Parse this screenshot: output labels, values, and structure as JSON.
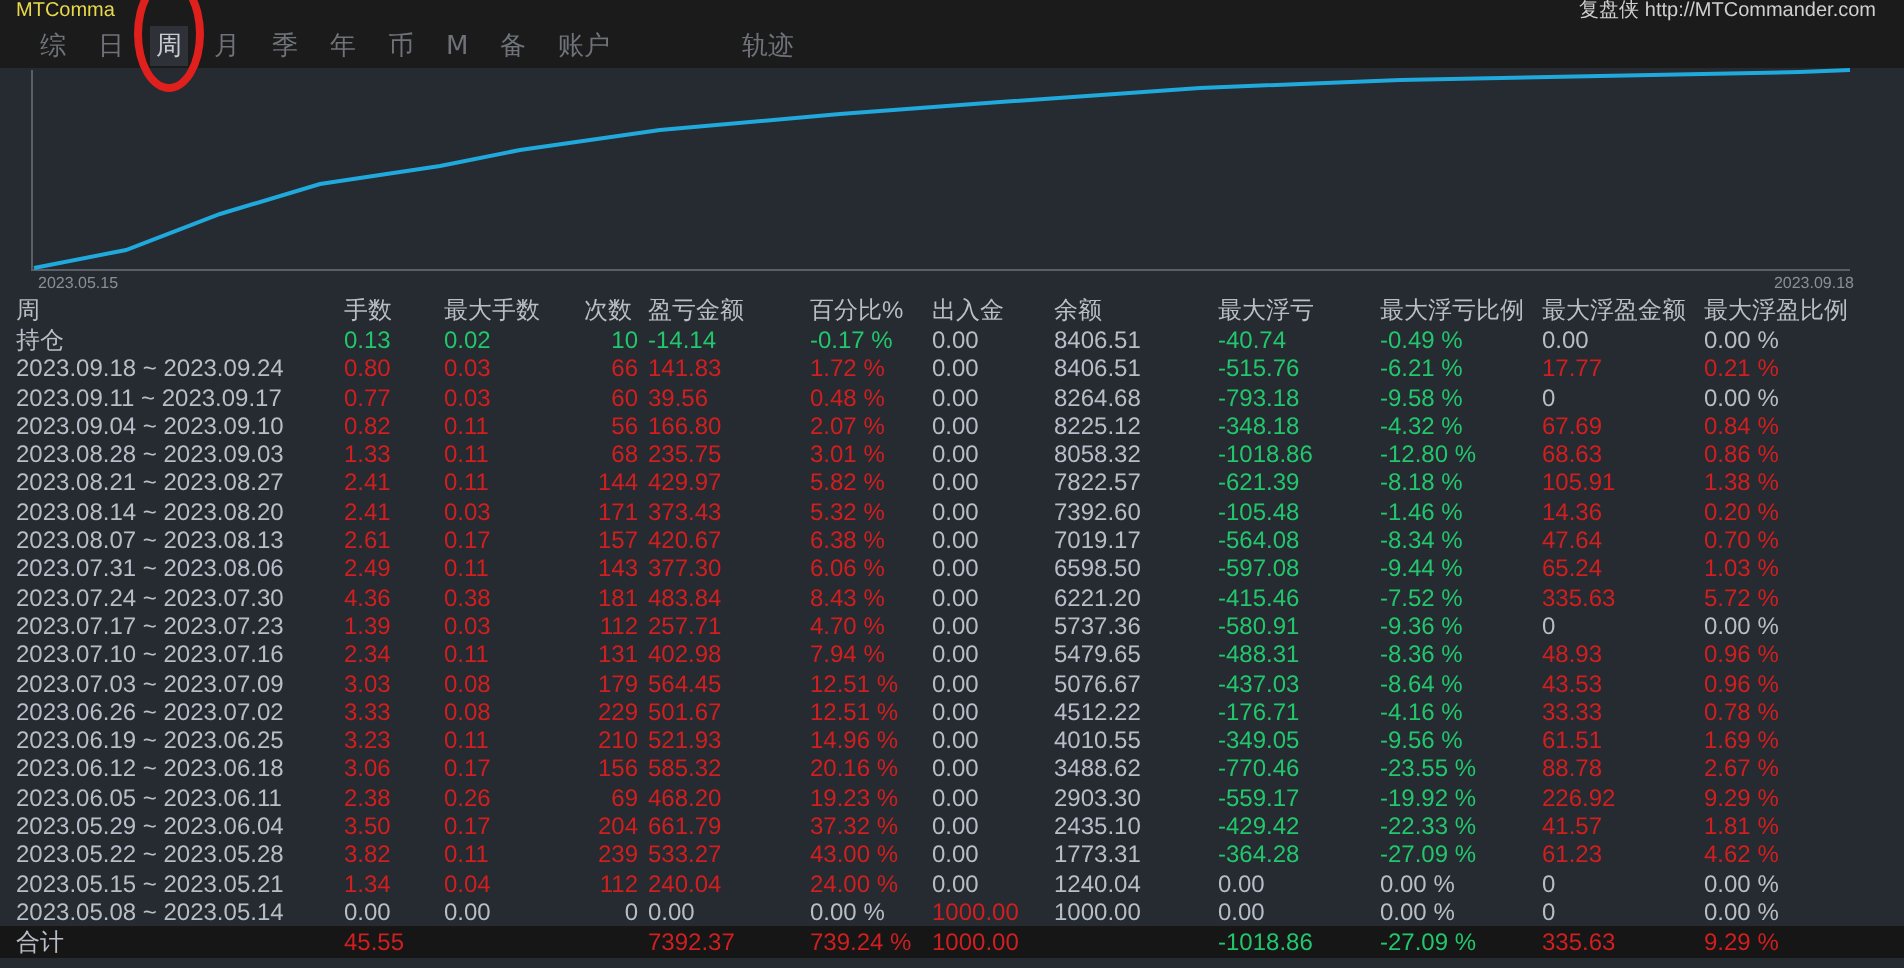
{
  "app": {
    "title": "MTComma",
    "brand": "复盘侠 http://MTCommander.com"
  },
  "tabs": [
    {
      "label": "综",
      "selected": false
    },
    {
      "label": "日",
      "selected": false
    },
    {
      "label": "周",
      "selected": true
    },
    {
      "label": "月",
      "selected": false
    },
    {
      "label": "季",
      "selected": false
    },
    {
      "label": "年",
      "selected": false
    },
    {
      "label": "币",
      "selected": false
    },
    {
      "label": "M",
      "selected": false
    },
    {
      "label": "备",
      "selected": false
    },
    {
      "label": "账户",
      "selected": false
    },
    {
      "label": "轨迹",
      "selected": false
    }
  ],
  "chart": {
    "start_label": "2023.05.15",
    "end_label": "2023.09.18"
  },
  "table": {
    "columns": [
      "周",
      "手数",
      "最大手数",
      "次数",
      "盈亏金额",
      "百分比%",
      "出入金",
      "余额",
      "最大浮亏",
      "最大浮亏比例",
      "最大浮盈金额",
      "最大浮盈比例"
    ],
    "rows": [
      {
        "cells": [
          {
            "text": "持仓",
            "kind": "label"
          },
          {
            "text": "0.13",
            "kind": "down"
          },
          {
            "text": "0.02",
            "kind": "down"
          },
          {
            "text": "10",
            "kind": "down"
          },
          {
            "text": "-14.14",
            "kind": "down"
          },
          {
            "text": "-0.17 %",
            "kind": "down"
          },
          {
            "text": "0.00",
            "kind": "flat"
          },
          {
            "text": "8406.51",
            "kind": "flat"
          },
          {
            "text": "-40.74",
            "kind": "down"
          },
          {
            "text": "-0.49 %",
            "kind": "down"
          },
          {
            "text": "0.00",
            "kind": "flat"
          },
          {
            "text": "0.00 %",
            "kind": "flat"
          }
        ]
      },
      {
        "cells": [
          {
            "text": "2023.09.18 ~ 2023.09.24",
            "kind": "label"
          },
          {
            "text": "0.80",
            "kind": "up"
          },
          {
            "text": "0.03",
            "kind": "up"
          },
          {
            "text": "66",
            "kind": "up"
          },
          {
            "text": "141.83",
            "kind": "up"
          },
          {
            "text": "1.72 %",
            "kind": "up"
          },
          {
            "text": "0.00",
            "kind": "flat"
          },
          {
            "text": "8406.51",
            "kind": "flat"
          },
          {
            "text": "-515.76",
            "kind": "down"
          },
          {
            "text": "-6.21 %",
            "kind": "down"
          },
          {
            "text": "17.77",
            "kind": "up"
          },
          {
            "text": "0.21 %",
            "kind": "up"
          }
        ]
      },
      {
        "cells": [
          {
            "text": "2023.09.11 ~ 2023.09.17",
            "kind": "label"
          },
          {
            "text": "0.77",
            "kind": "up"
          },
          {
            "text": "0.03",
            "kind": "up"
          },
          {
            "text": "60",
            "kind": "up"
          },
          {
            "text": "39.56",
            "kind": "up"
          },
          {
            "text": "0.48 %",
            "kind": "up"
          },
          {
            "text": "0.00",
            "kind": "flat"
          },
          {
            "text": "8264.68",
            "kind": "flat"
          },
          {
            "text": "-793.18",
            "kind": "down"
          },
          {
            "text": "-9.58 %",
            "kind": "down"
          },
          {
            "text": "0",
            "kind": "flat"
          },
          {
            "text": "0.00 %",
            "kind": "flat"
          }
        ]
      },
      {
        "cells": [
          {
            "text": "2023.09.04 ~ 2023.09.10",
            "kind": "label"
          },
          {
            "text": "0.82",
            "kind": "up"
          },
          {
            "text": "0.11",
            "kind": "up"
          },
          {
            "text": "56",
            "kind": "up"
          },
          {
            "text": "166.80",
            "kind": "up"
          },
          {
            "text": "2.07 %",
            "kind": "up"
          },
          {
            "text": "0.00",
            "kind": "flat"
          },
          {
            "text": "8225.12",
            "kind": "flat"
          },
          {
            "text": "-348.18",
            "kind": "down"
          },
          {
            "text": "-4.32 %",
            "kind": "down"
          },
          {
            "text": "67.69",
            "kind": "up"
          },
          {
            "text": "0.84 %",
            "kind": "up"
          }
        ]
      },
      {
        "cells": [
          {
            "text": "2023.08.28 ~ 2023.09.03",
            "kind": "label"
          },
          {
            "text": "1.33",
            "kind": "up"
          },
          {
            "text": "0.11",
            "kind": "up"
          },
          {
            "text": "68",
            "kind": "up"
          },
          {
            "text": "235.75",
            "kind": "up"
          },
          {
            "text": "3.01 %",
            "kind": "up"
          },
          {
            "text": "0.00",
            "kind": "flat"
          },
          {
            "text": "8058.32",
            "kind": "flat"
          },
          {
            "text": "-1018.86",
            "kind": "down"
          },
          {
            "text": "-12.80 %",
            "kind": "down"
          },
          {
            "text": "68.63",
            "kind": "up"
          },
          {
            "text": "0.86 %",
            "kind": "up"
          }
        ]
      },
      {
        "cells": [
          {
            "text": "2023.08.21 ~ 2023.08.27",
            "kind": "label"
          },
          {
            "text": "2.41",
            "kind": "up"
          },
          {
            "text": "0.11",
            "kind": "up"
          },
          {
            "text": "144",
            "kind": "up"
          },
          {
            "text": "429.97",
            "kind": "up"
          },
          {
            "text": "5.82 %",
            "kind": "up"
          },
          {
            "text": "0.00",
            "kind": "flat"
          },
          {
            "text": "7822.57",
            "kind": "flat"
          },
          {
            "text": "-621.39",
            "kind": "down"
          },
          {
            "text": "-8.18 %",
            "kind": "down"
          },
          {
            "text": "105.91",
            "kind": "up"
          },
          {
            "text": "1.38 %",
            "kind": "up"
          }
        ]
      },
      {
        "cells": [
          {
            "text": "2023.08.14 ~ 2023.08.20",
            "kind": "label"
          },
          {
            "text": "2.41",
            "kind": "up"
          },
          {
            "text": "0.03",
            "kind": "up"
          },
          {
            "text": "171",
            "kind": "up"
          },
          {
            "text": "373.43",
            "kind": "up"
          },
          {
            "text": "5.32 %",
            "kind": "up"
          },
          {
            "text": "0.00",
            "kind": "flat"
          },
          {
            "text": "7392.60",
            "kind": "flat"
          },
          {
            "text": "-105.48",
            "kind": "down"
          },
          {
            "text": "-1.46 %",
            "kind": "down"
          },
          {
            "text": "14.36",
            "kind": "up"
          },
          {
            "text": "0.20 %",
            "kind": "up"
          }
        ]
      },
      {
        "cells": [
          {
            "text": "2023.08.07 ~ 2023.08.13",
            "kind": "label"
          },
          {
            "text": "2.61",
            "kind": "up"
          },
          {
            "text": "0.17",
            "kind": "up"
          },
          {
            "text": "157",
            "kind": "up"
          },
          {
            "text": "420.67",
            "kind": "up"
          },
          {
            "text": "6.38 %",
            "kind": "up"
          },
          {
            "text": "0.00",
            "kind": "flat"
          },
          {
            "text": "7019.17",
            "kind": "flat"
          },
          {
            "text": "-564.08",
            "kind": "down"
          },
          {
            "text": "-8.34 %",
            "kind": "down"
          },
          {
            "text": "47.64",
            "kind": "up"
          },
          {
            "text": "0.70 %",
            "kind": "up"
          }
        ]
      },
      {
        "cells": [
          {
            "text": "2023.07.31 ~ 2023.08.06",
            "kind": "label"
          },
          {
            "text": "2.49",
            "kind": "up"
          },
          {
            "text": "0.11",
            "kind": "up"
          },
          {
            "text": "143",
            "kind": "up"
          },
          {
            "text": "377.30",
            "kind": "up"
          },
          {
            "text": "6.06 %",
            "kind": "up"
          },
          {
            "text": "0.00",
            "kind": "flat"
          },
          {
            "text": "6598.50",
            "kind": "flat"
          },
          {
            "text": "-597.08",
            "kind": "down"
          },
          {
            "text": "-9.44 %",
            "kind": "down"
          },
          {
            "text": "65.24",
            "kind": "up"
          },
          {
            "text": "1.03 %",
            "kind": "up"
          }
        ]
      },
      {
        "cells": [
          {
            "text": "2023.07.24 ~ 2023.07.30",
            "kind": "label"
          },
          {
            "text": "4.36",
            "kind": "up"
          },
          {
            "text": "0.38",
            "kind": "up"
          },
          {
            "text": "181",
            "kind": "up"
          },
          {
            "text": "483.84",
            "kind": "up"
          },
          {
            "text": "8.43 %",
            "kind": "up"
          },
          {
            "text": "0.00",
            "kind": "flat"
          },
          {
            "text": "6221.20",
            "kind": "flat"
          },
          {
            "text": "-415.46",
            "kind": "down"
          },
          {
            "text": "-7.52 %",
            "kind": "down"
          },
          {
            "text": "335.63",
            "kind": "up"
          },
          {
            "text": "5.72 %",
            "kind": "up"
          }
        ]
      },
      {
        "cells": [
          {
            "text": "2023.07.17 ~ 2023.07.23",
            "kind": "label"
          },
          {
            "text": "1.39",
            "kind": "up"
          },
          {
            "text": "0.03",
            "kind": "up"
          },
          {
            "text": "112",
            "kind": "up"
          },
          {
            "text": "257.71",
            "kind": "up"
          },
          {
            "text": "4.70 %",
            "kind": "up"
          },
          {
            "text": "0.00",
            "kind": "flat"
          },
          {
            "text": "5737.36",
            "kind": "flat"
          },
          {
            "text": "-580.91",
            "kind": "down"
          },
          {
            "text": "-9.36 %",
            "kind": "down"
          },
          {
            "text": "0",
            "kind": "flat"
          },
          {
            "text": "0.00 %",
            "kind": "flat"
          }
        ]
      },
      {
        "cells": [
          {
            "text": "2023.07.10 ~ 2023.07.16",
            "kind": "label"
          },
          {
            "text": "2.34",
            "kind": "up"
          },
          {
            "text": "0.11",
            "kind": "up"
          },
          {
            "text": "131",
            "kind": "up"
          },
          {
            "text": "402.98",
            "kind": "up"
          },
          {
            "text": "7.94 %",
            "kind": "up"
          },
          {
            "text": "0.00",
            "kind": "flat"
          },
          {
            "text": "5479.65",
            "kind": "flat"
          },
          {
            "text": "-488.31",
            "kind": "down"
          },
          {
            "text": "-8.36 %",
            "kind": "down"
          },
          {
            "text": "48.93",
            "kind": "up"
          },
          {
            "text": "0.96 %",
            "kind": "up"
          }
        ]
      },
      {
        "cells": [
          {
            "text": "2023.07.03 ~ 2023.07.09",
            "kind": "label"
          },
          {
            "text": "3.03",
            "kind": "up"
          },
          {
            "text": "0.08",
            "kind": "up"
          },
          {
            "text": "179",
            "kind": "up"
          },
          {
            "text": "564.45",
            "kind": "up"
          },
          {
            "text": "12.51 %",
            "kind": "up"
          },
          {
            "text": "0.00",
            "kind": "flat"
          },
          {
            "text": "5076.67",
            "kind": "flat"
          },
          {
            "text": "-437.03",
            "kind": "down"
          },
          {
            "text": "-8.64 %",
            "kind": "down"
          },
          {
            "text": "43.53",
            "kind": "up"
          },
          {
            "text": "0.96 %",
            "kind": "up"
          }
        ]
      },
      {
        "cells": [
          {
            "text": "2023.06.26 ~ 2023.07.02",
            "kind": "label"
          },
          {
            "text": "3.33",
            "kind": "up"
          },
          {
            "text": "0.08",
            "kind": "up"
          },
          {
            "text": "229",
            "kind": "up"
          },
          {
            "text": "501.67",
            "kind": "up"
          },
          {
            "text": "12.51 %",
            "kind": "up"
          },
          {
            "text": "0.00",
            "kind": "flat"
          },
          {
            "text": "4512.22",
            "kind": "flat"
          },
          {
            "text": "-176.71",
            "kind": "down"
          },
          {
            "text": "-4.16 %",
            "kind": "down"
          },
          {
            "text": "33.33",
            "kind": "up"
          },
          {
            "text": "0.78 %",
            "kind": "up"
          }
        ]
      },
      {
        "cells": [
          {
            "text": "2023.06.19 ~ 2023.06.25",
            "kind": "label"
          },
          {
            "text": "3.23",
            "kind": "up"
          },
          {
            "text": "0.11",
            "kind": "up"
          },
          {
            "text": "210",
            "kind": "up"
          },
          {
            "text": "521.93",
            "kind": "up"
          },
          {
            "text": "14.96 %",
            "kind": "up"
          },
          {
            "text": "0.00",
            "kind": "flat"
          },
          {
            "text": "4010.55",
            "kind": "flat"
          },
          {
            "text": "-349.05",
            "kind": "down"
          },
          {
            "text": "-9.56 %",
            "kind": "down"
          },
          {
            "text": "61.51",
            "kind": "up"
          },
          {
            "text": "1.69 %",
            "kind": "up"
          }
        ]
      },
      {
        "cells": [
          {
            "text": "2023.06.12 ~ 2023.06.18",
            "kind": "label"
          },
          {
            "text": "3.06",
            "kind": "up"
          },
          {
            "text": "0.17",
            "kind": "up"
          },
          {
            "text": "156",
            "kind": "up"
          },
          {
            "text": "585.32",
            "kind": "up"
          },
          {
            "text": "20.16 %",
            "kind": "up"
          },
          {
            "text": "0.00",
            "kind": "flat"
          },
          {
            "text": "3488.62",
            "kind": "flat"
          },
          {
            "text": "-770.46",
            "kind": "down"
          },
          {
            "text": "-23.55 %",
            "kind": "down"
          },
          {
            "text": "88.78",
            "kind": "up"
          },
          {
            "text": "2.67 %",
            "kind": "up"
          }
        ]
      },
      {
        "cells": [
          {
            "text": "2023.06.05 ~ 2023.06.11",
            "kind": "label"
          },
          {
            "text": "2.38",
            "kind": "up"
          },
          {
            "text": "0.26",
            "kind": "up"
          },
          {
            "text": "69",
            "kind": "up"
          },
          {
            "text": "468.20",
            "kind": "up"
          },
          {
            "text": "19.23 %",
            "kind": "up"
          },
          {
            "text": "0.00",
            "kind": "flat"
          },
          {
            "text": "2903.30",
            "kind": "flat"
          },
          {
            "text": "-559.17",
            "kind": "down"
          },
          {
            "text": "-19.92 %",
            "kind": "down"
          },
          {
            "text": "226.92",
            "kind": "up"
          },
          {
            "text": "9.29 %",
            "kind": "up"
          }
        ]
      },
      {
        "cells": [
          {
            "text": "2023.05.29 ~ 2023.06.04",
            "kind": "label"
          },
          {
            "text": "3.50",
            "kind": "up"
          },
          {
            "text": "0.17",
            "kind": "up"
          },
          {
            "text": "204",
            "kind": "up"
          },
          {
            "text": "661.79",
            "kind": "up"
          },
          {
            "text": "37.32 %",
            "kind": "up"
          },
          {
            "text": "0.00",
            "kind": "flat"
          },
          {
            "text": "2435.10",
            "kind": "flat"
          },
          {
            "text": "-429.42",
            "kind": "down"
          },
          {
            "text": "-22.33 %",
            "kind": "down"
          },
          {
            "text": "41.57",
            "kind": "up"
          },
          {
            "text": "1.81 %",
            "kind": "up"
          }
        ]
      },
      {
        "cells": [
          {
            "text": "2023.05.22 ~ 2023.05.28",
            "kind": "label"
          },
          {
            "text": "3.82",
            "kind": "up"
          },
          {
            "text": "0.11",
            "kind": "up"
          },
          {
            "text": "239",
            "kind": "up"
          },
          {
            "text": "533.27",
            "kind": "up"
          },
          {
            "text": "43.00 %",
            "kind": "up"
          },
          {
            "text": "0.00",
            "kind": "flat"
          },
          {
            "text": "1773.31",
            "kind": "flat"
          },
          {
            "text": "-364.28",
            "kind": "down"
          },
          {
            "text": "-27.09 %",
            "kind": "down"
          },
          {
            "text": "61.23",
            "kind": "up"
          },
          {
            "text": "4.62 %",
            "kind": "up"
          }
        ]
      },
      {
        "cells": [
          {
            "text": "2023.05.15 ~ 2023.05.21",
            "kind": "label"
          },
          {
            "text": "1.34",
            "kind": "up"
          },
          {
            "text": "0.04",
            "kind": "up"
          },
          {
            "text": "112",
            "kind": "up"
          },
          {
            "text": "240.04",
            "kind": "up"
          },
          {
            "text": "24.00 %",
            "kind": "up"
          },
          {
            "text": "0.00",
            "kind": "flat"
          },
          {
            "text": "1240.04",
            "kind": "flat"
          },
          {
            "text": "0.00",
            "kind": "flat"
          },
          {
            "text": "0.00 %",
            "kind": "flat"
          },
          {
            "text": "0",
            "kind": "flat"
          },
          {
            "text": "0.00 %",
            "kind": "flat"
          }
        ]
      },
      {
        "cells": [
          {
            "text": "2023.05.08 ~ 2023.05.14",
            "kind": "label"
          },
          {
            "text": "0.00",
            "kind": "flat"
          },
          {
            "text": "0.00",
            "kind": "flat"
          },
          {
            "text": "0",
            "kind": "flat"
          },
          {
            "text": "0.00",
            "kind": "flat"
          },
          {
            "text": "0.00 %",
            "kind": "flat"
          },
          {
            "text": "1000.00",
            "kind": "up"
          },
          {
            "text": "1000.00",
            "kind": "flat"
          },
          {
            "text": "0.00",
            "kind": "flat"
          },
          {
            "text": "0.00 %",
            "kind": "flat"
          },
          {
            "text": "0",
            "kind": "flat"
          },
          {
            "text": "0.00 %",
            "kind": "flat"
          }
        ]
      }
    ],
    "total": {
      "cells": [
        {
          "text": "合计",
          "kind": "label"
        },
        {
          "text": "45.55",
          "kind": "up"
        },
        {
          "kind": "blank"
        },
        {
          "kind": "blank"
        },
        {
          "text": "7392.37",
          "kind": "up"
        },
        {
          "text": "739.24 %",
          "kind": "up"
        },
        {
          "text": "1000.00",
          "kind": "up"
        },
        {
          "kind": "blank"
        },
        {
          "text": "-1018.86",
          "kind": "down"
        },
        {
          "text": "-27.09 %",
          "kind": "down"
        },
        {
          "text": "335.63",
          "kind": "up"
        },
        {
          "text": "9.29 %",
          "kind": "up"
        }
      ]
    }
  }
}
